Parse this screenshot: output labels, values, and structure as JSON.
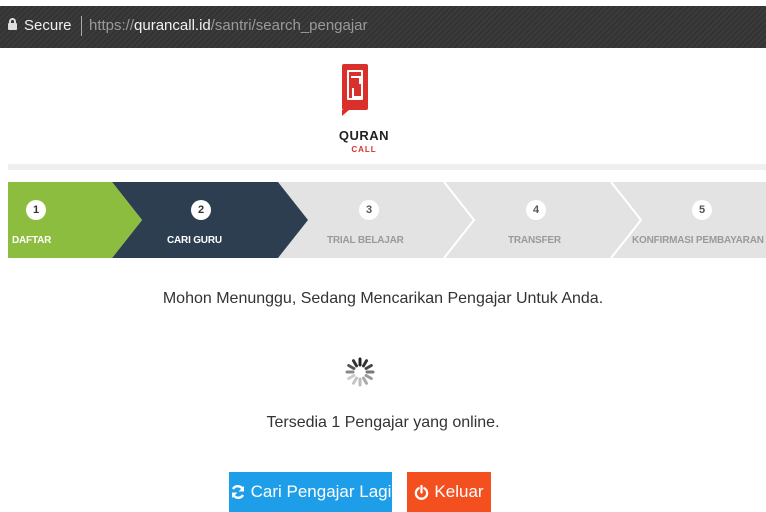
{
  "browser": {
    "secure_label": "Secure",
    "url_scheme": "https://",
    "url_host": "qurancall.id",
    "url_path": "/santri/search_pengajar"
  },
  "logo": {
    "title": "QURAN",
    "subtitle": "CALL",
    "brand_color": "#d9302c"
  },
  "steps": [
    {
      "number": "1",
      "label": "DAFTAR",
      "state": "done",
      "color": "#8cbd3f"
    },
    {
      "number": "2",
      "label": "CARI GURU",
      "state": "active",
      "color": "#2c3e50"
    },
    {
      "number": "3",
      "label": "TRIAL BELAJAR",
      "state": "pending",
      "color": "#e3e3e3"
    },
    {
      "number": "4",
      "label": "TRANSFER",
      "state": "pending",
      "color": "#e3e3e3"
    },
    {
      "number": "5",
      "label": "KONFIRMASI PEMBAYARAN",
      "state": "pending",
      "color": "#e3e3e3"
    }
  ],
  "main": {
    "waiting_message": "Mohon Menunggu, Sedang Mencarikan Pengajar Untuk Anda.",
    "spinner_icon": "loading-spinner-icon",
    "online_message": "Tersedia 1 Pengajar yang online."
  },
  "buttons": {
    "search_again": {
      "label": "Cari Pengajar Lagi",
      "icon": "refresh-icon",
      "color": "#1e9ee8"
    },
    "exit": {
      "label": "Keluar",
      "icon": "power-icon",
      "color": "#f4501f"
    }
  }
}
